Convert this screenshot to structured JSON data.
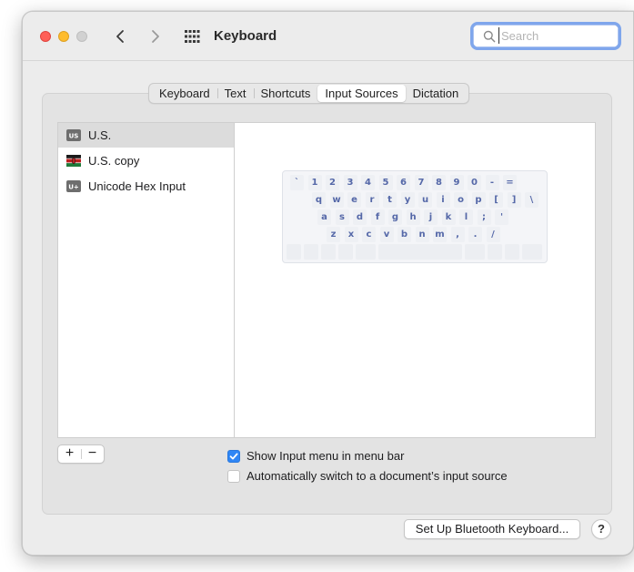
{
  "window": {
    "title": "Keyboard",
    "search_placeholder": "Search"
  },
  "tabs": [
    {
      "label": "Keyboard",
      "active": false
    },
    {
      "label": "Text",
      "active": false
    },
    {
      "label": "Shortcuts",
      "active": false
    },
    {
      "label": "Input Sources",
      "active": true
    },
    {
      "label": "Dictation",
      "active": false
    }
  ],
  "input_sources": [
    {
      "label": "U.S.",
      "icon": "us-flag-icon",
      "icon_text": "US",
      "selected": true
    },
    {
      "label": "U.S. copy",
      "icon": "kenya-flag-icon",
      "selected": false
    },
    {
      "label": "Unicode Hex Input",
      "icon": "unicode-hex-icon",
      "icon_text": "U+",
      "selected": false
    }
  ],
  "keyboard_preview": {
    "rows": [
      [
        "`",
        "1",
        "2",
        "3",
        "4",
        "5",
        "6",
        "7",
        "8",
        "9",
        "0",
        "-",
        "="
      ],
      [
        "q",
        "w",
        "e",
        "r",
        "t",
        "y",
        "u",
        "i",
        "o",
        "p",
        "[",
        "]",
        "\\"
      ],
      [
        "a",
        "s",
        "d",
        "f",
        "g",
        "h",
        "j",
        "k",
        "l",
        ";",
        "'"
      ],
      [
        "z",
        "x",
        "c",
        "v",
        "b",
        "n",
        "m",
        ",",
        ".",
        "/"
      ]
    ],
    "key_color": "#5568a8"
  },
  "list_controls": {
    "add": "+",
    "remove": "−"
  },
  "options": {
    "show_input_menu": {
      "label": "Show Input menu in menu bar",
      "checked": true
    },
    "auto_switch": {
      "label": "Automatically switch to a document’s input source",
      "checked": false
    }
  },
  "buttons": {
    "bluetooth": "Set Up Bluetooth Keyboard...",
    "help": "?"
  },
  "colors": {
    "accent": "#2f86f5",
    "traffic_close": "#ff5f57",
    "traffic_minimize": "#febc2e",
    "traffic_inactive": "#d1d1d1"
  }
}
